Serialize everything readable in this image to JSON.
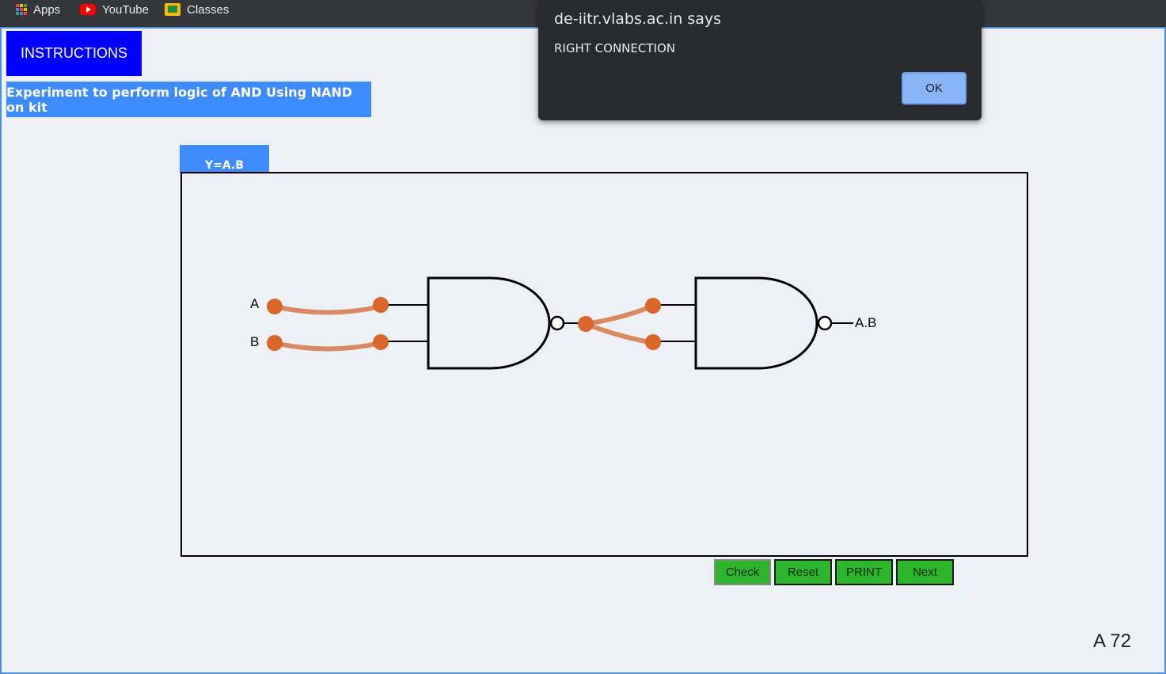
{
  "bookmarks": [
    {
      "label": "Apps",
      "icon": "apps-grid-icon"
    },
    {
      "label": "YouTube",
      "icon": "youtube-icon"
    },
    {
      "label": "Classes",
      "icon": "google-classroom-icon"
    }
  ],
  "page": {
    "instructions_label": "INSTRUCTIONS",
    "experiment_title": "Experiment to perform logic of AND Using NAND on kit",
    "equation_tab": "Y=A.B",
    "corner_label": "A 72"
  },
  "circuit": {
    "input_a": "A",
    "input_b": "B",
    "output": "A.B",
    "gates": [
      "NAND",
      "NAND"
    ],
    "wire_color": "#d98a63",
    "node_color": "#d9662a"
  },
  "controls": {
    "check": "Check",
    "reset": "Reset",
    "print": "PRINT",
    "next": "Next",
    "button_color": "#2db52d"
  },
  "dialog": {
    "title": "de-iitr.vlabs.ac.in says",
    "message": "RIGHT CONNECTION",
    "ok": "OK"
  }
}
